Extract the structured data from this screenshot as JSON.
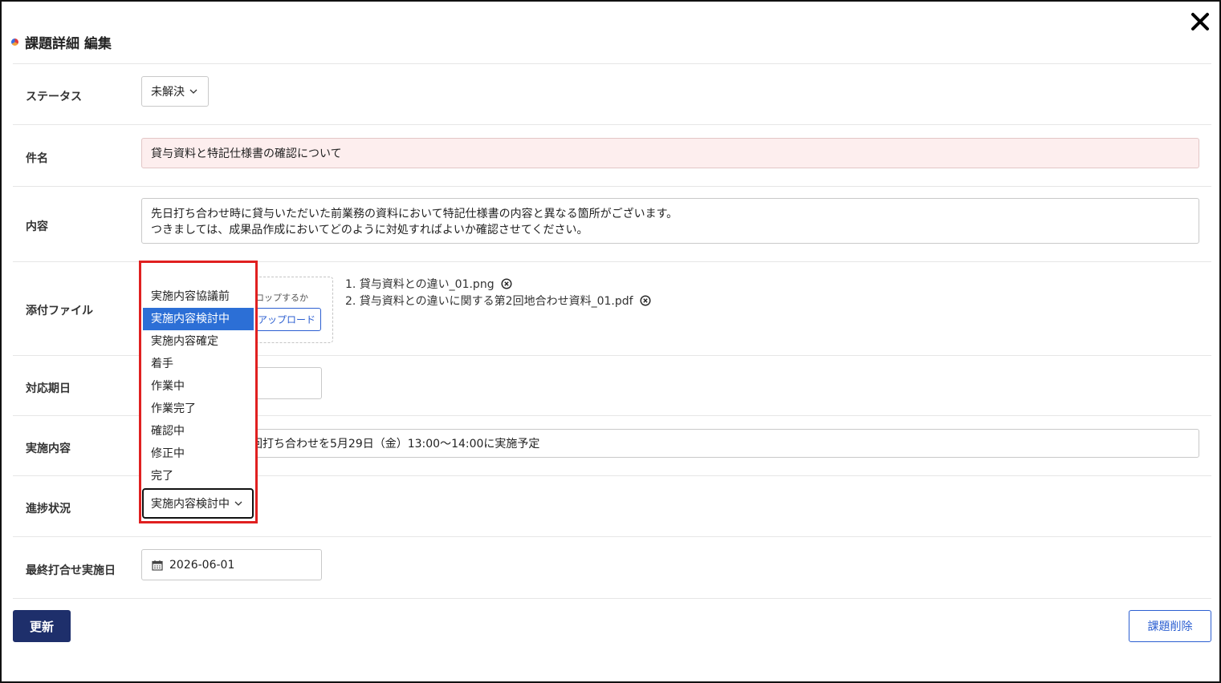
{
  "dialog": {
    "title": "課題詳細 編集",
    "close_label": "×"
  },
  "status": {
    "label": "ステータス",
    "value": "未解決"
  },
  "subject": {
    "label": "件名",
    "value": "貸与資料と特記仕様書の確認について"
  },
  "content": {
    "label": "内容",
    "line1": "先日打ち合わせ時に貸与いただいた前業務の資料において特記仕様書の内容と異なる箇所がございます。",
    "line2": "つきましては、成果品作成においてどのように対処すればよいか確認させてください。"
  },
  "attachments": {
    "label": "添付ファイル",
    "drop_hint": "ロップするか",
    "upload_label": "アップロード",
    "files": [
      "1. 貸与資料との違い_01.png",
      "2. 貸与資料との違いに関する第2回地合わせ資料_01.pdf"
    ]
  },
  "due_date": {
    "label": "対応期日",
    "value": ""
  },
  "implementation": {
    "label": "実施内容",
    "value": "回打ち合わせを5月29日（金）13:00～14:00に実施予定"
  },
  "progress": {
    "label": "進捗状況",
    "value": "実施内容検討中",
    "options": [
      "実施内容協議前",
      "実施内容検討中",
      "実施内容確定",
      "着手",
      "作業中",
      "作業完了",
      "確認中",
      "修正中",
      "完了"
    ],
    "selected_index": 1
  },
  "last_meeting": {
    "label": "最終打合せ実施日",
    "value": "2026-06-01"
  },
  "actions": {
    "update_label": "更新",
    "delete_label": "課題削除"
  },
  "colors": {
    "primary": "#1e2f6b",
    "accent": "#2c6fd6",
    "highlight_border": "#e02020",
    "subject_bg": "#fdeeee"
  }
}
